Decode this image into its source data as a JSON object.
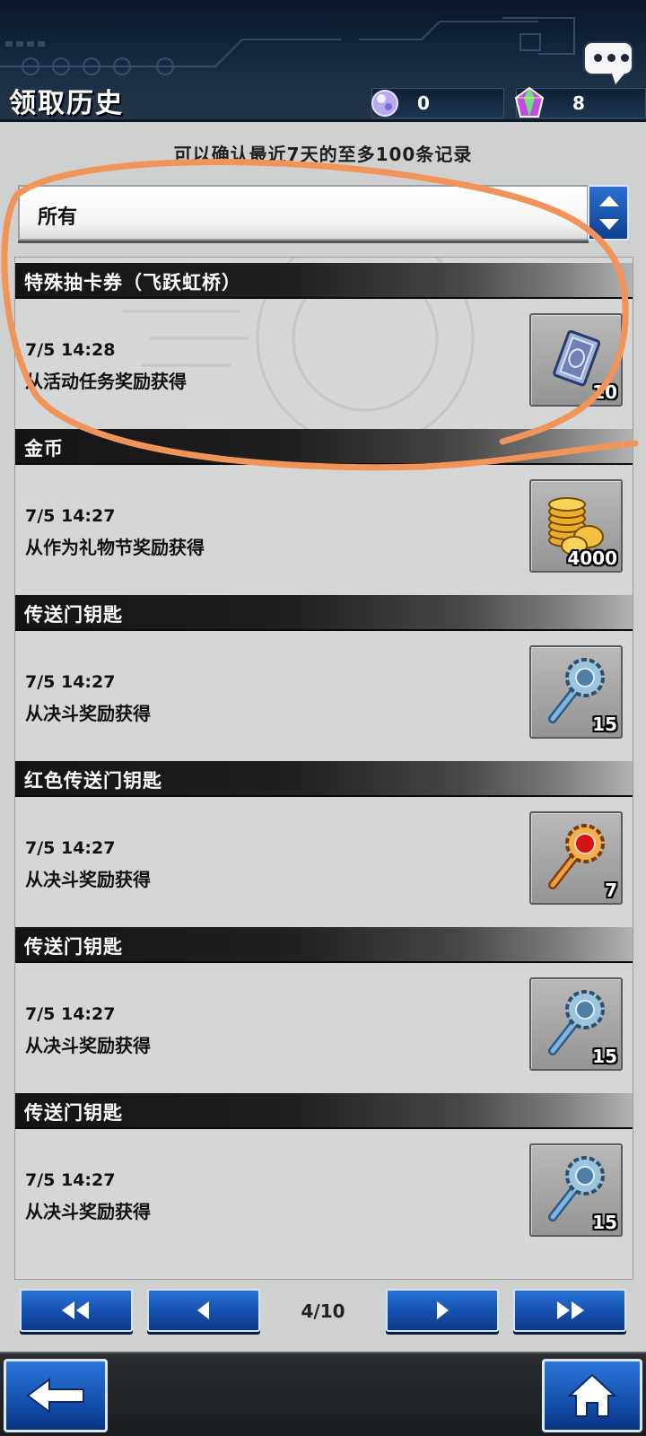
{
  "header": {
    "title": "领取历史",
    "currencies": [
      {
        "icon": "orb-icon",
        "value": "0"
      },
      {
        "icon": "gem-icon",
        "value": "8"
      }
    ],
    "chat_icon": "chat-bubble-icon"
  },
  "subtitle": "可以确认最近7天的至多100条记录",
  "filter": {
    "selected": "所有",
    "arrows_icon": "up-down-arrows-icon"
  },
  "items": [
    {
      "category": "特殊抽卡券（飞跃虹桥）",
      "time": "7/5 14:28",
      "source": "从活动任务奖励获得",
      "icon": "card-ticket-icon",
      "quantity": "10"
    },
    {
      "category": "金币",
      "time": "7/5 14:27",
      "source": "从作为礼物节奖励获得",
      "icon": "gold-coins-icon",
      "quantity": "4000"
    },
    {
      "category": "传送门钥匙",
      "time": "7/5 14:27",
      "source": "从决斗奖励获得",
      "icon": "blue-key-icon",
      "quantity": "15"
    },
    {
      "category": "红色传送门钥匙",
      "time": "7/5 14:27",
      "source": "从决斗奖励获得",
      "icon": "red-key-icon",
      "quantity": "7"
    },
    {
      "category": "传送门钥匙",
      "time": "7/5 14:27",
      "source": "从决斗奖励获得",
      "icon": "blue-key-icon",
      "quantity": "15"
    },
    {
      "category": "传送门钥匙",
      "time": "7/5 14:27",
      "source": "从决斗奖励获得",
      "icon": "blue-key-icon",
      "quantity": "15"
    }
  ],
  "pagination": {
    "page": "4/10",
    "buttons": [
      "first-page-icon",
      "previous-page-icon",
      "next-page-icon",
      "last-page-icon"
    ]
  },
  "footer": {
    "back_icon": "back-arrow-icon",
    "home_icon": "home-icon"
  },
  "colors": {
    "accent_blue": "#1550ad",
    "annotation_orange": "#f0945a",
    "header_dark": "#13253b"
  }
}
